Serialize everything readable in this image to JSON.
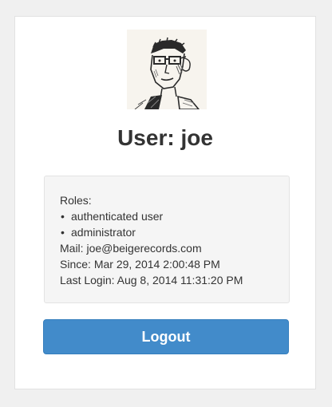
{
  "header": {
    "title_prefix": "User:",
    "username": "joe"
  },
  "avatar": {
    "icon": "user-sketch-portrait"
  },
  "info": {
    "roles_label": "Roles:",
    "roles": [
      "authenticated user",
      "administrator"
    ],
    "mail_label": "Mail:",
    "mail_value": "joe@beigerecords.com",
    "since_label": "Since:",
    "since_value": "Mar 29, 2014 2:00:48 PM",
    "last_login_label": "Last Login:",
    "last_login_value": "Aug 8, 2014 11:31:20 PM"
  },
  "actions": {
    "logout_label": "Logout"
  },
  "colors": {
    "primary_button": "#428bca",
    "panel_background": "#f5f5f5",
    "page_background": "#f0f0f0"
  }
}
